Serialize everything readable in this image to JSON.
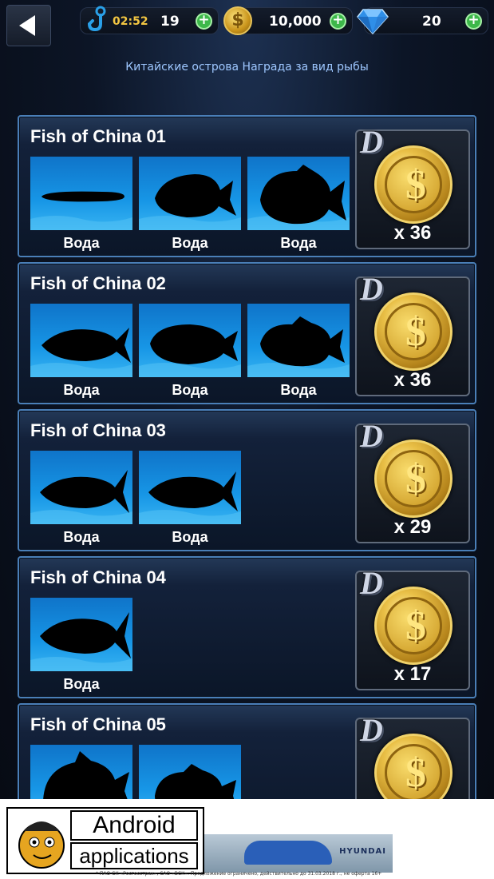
{
  "header": {
    "timer": "02:52",
    "energy": "19",
    "coins": "10,000",
    "gems": "20",
    "plus_symbol": "+",
    "back_icon": "back-arrow-icon",
    "hook_icon": "fishing-hook-icon",
    "coin_icon": "gold-coin-icon",
    "gem_icon": "diamond-gem-icon"
  },
  "subtitle": "Китайские острова Награда за вид рыбы",
  "cards": [
    {
      "title": "Fish of China 01",
      "grade": "D",
      "reward": "x 36",
      "fish": [
        {
          "label": "Вода"
        },
        {
          "label": "Вода"
        },
        {
          "label": "Вода"
        }
      ]
    },
    {
      "title": "Fish of China 02",
      "grade": "D",
      "reward": "x 36",
      "fish": [
        {
          "label": "Вода"
        },
        {
          "label": "Вода"
        },
        {
          "label": "Вода"
        }
      ]
    },
    {
      "title": "Fish of China 03",
      "grade": "D",
      "reward": "x 29",
      "fish": [
        {
          "label": "Вода"
        },
        {
          "label": "Вода"
        }
      ]
    },
    {
      "title": "Fish of China 04",
      "grade": "D",
      "reward": "x 17",
      "fish": [
        {
          "label": "Вода"
        }
      ]
    },
    {
      "title": "Fish of China 05",
      "grade": "D",
      "reward": "",
      "fish": [
        {
          "label": ""
        },
        {
          "label": ""
        }
      ]
    }
  ],
  "coin_sign": "$",
  "ad": {
    "line1": "Android",
    "line2": "applications",
    "brand": "HYUNDAI",
    "fine_print": "* ПАО СК «Росгосстрах», САО «ВСК». Предложение ограничено, действительно до 31.03.2018 г., не оферта 16+"
  },
  "colors": {
    "accent_border": "#4a7fb8",
    "timer": "#f2c642",
    "plus_button": "#3db84a",
    "subtitle": "#9ec7ff",
    "water": "#1796e6"
  }
}
